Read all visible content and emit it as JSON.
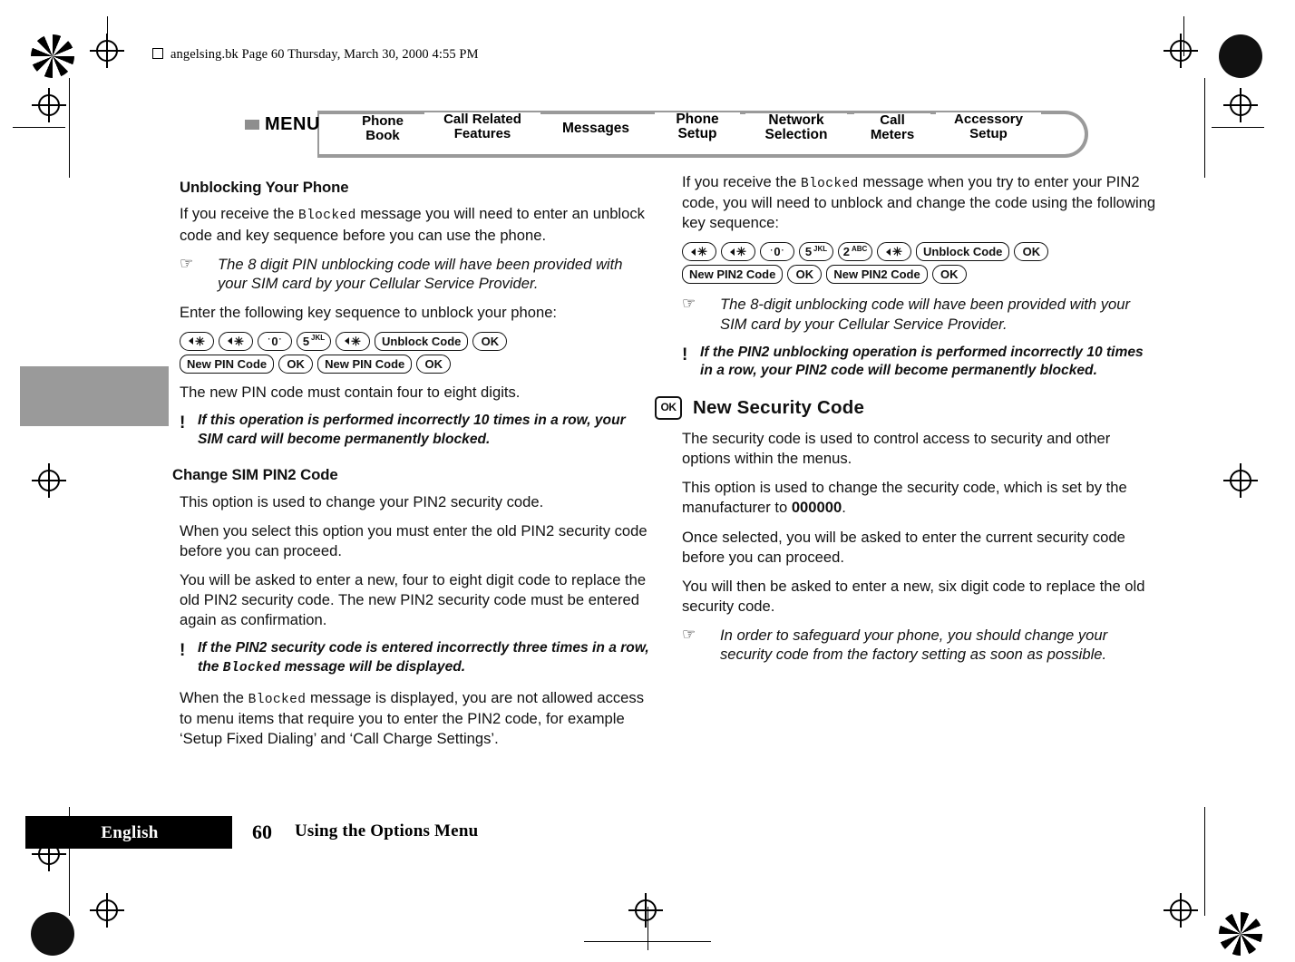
{
  "header": {
    "file_line": "angelsing.bk  Page 60  Thursday, March 30, 2000  4:55 PM"
  },
  "menu_bar": {
    "menu_word": "MENU",
    "items": [
      {
        "label": "Phone\nBook"
      },
      {
        "label": "Call Related\nFeatures"
      },
      {
        "label": "Messages"
      },
      {
        "label": "Phone\nSetup"
      },
      {
        "label": "Network\nSelection"
      },
      {
        "label": "Call\nMeters"
      },
      {
        "label": "Accessory\nSetup"
      }
    ]
  },
  "left_column": {
    "heading_unblocking": "Unblocking Your Phone",
    "p1_a": "If you receive the ",
    "p1_mono": "Blocked",
    "p1_b": " message you will need to enter an unblock code and key sequence before you can use the phone.",
    "note1": "The 8 digit PIN unblocking code will have been provided with your SIM card by your Cellular Service Provider.",
    "p2": "Enter the following key sequence to unblock your phone:",
    "keys_row1": [
      {
        "type": "star"
      },
      {
        "type": "star"
      },
      {
        "type": "zero",
        "label": "0"
      },
      {
        "type": "num",
        "label": "5",
        "sub": "JKL"
      },
      {
        "type": "star"
      },
      {
        "type": "text",
        "label": "Unblock Code"
      },
      {
        "type": "ok",
        "label": "OK"
      }
    ],
    "keys_row2": [
      {
        "type": "text",
        "label": "New PIN Code"
      },
      {
        "type": "ok",
        "label": "OK"
      },
      {
        "type": "text",
        "label": "New PIN Code"
      },
      {
        "type": "ok",
        "label": "OK"
      }
    ],
    "p3": "The new PIN code must contain four to eight digits.",
    "warn1": "If this operation is performed incorrectly 10 times in a row, your SIM card will become permanently blocked.",
    "heading_change_pin2": "Change SIM PIN2 Code",
    "p4": "This option is used to change your PIN2 security code.",
    "p5": "When you select this option you must enter the old PIN2 security code before you can proceed.",
    "p6": "You will be asked to enter a new, four to eight digit code to replace the old PIN2 security code. The new PIN2 security code must be entered again as confirmation.",
    "warn2_a": "If the PIN2 security code is entered incorrectly three times in a row, the ",
    "warn2_mono": "Blocked",
    "warn2_b": " message will be displayed.",
    "p7_a": "When the ",
    "p7_mono": "Blocked",
    "p7_b": " message is displayed, you are not allowed access to menu items that require you to enter the PIN2 code, for example ‘Setup Fixed Dialing’ and ‘Call Charge Settings’."
  },
  "right_column": {
    "p1_a": "If you receive the ",
    "p1_mono": "Blocked",
    "p1_b": " message when you try to enter your PIN2 code, you will need to unblock and change the code using the following key sequence:",
    "keys_row1": [
      {
        "type": "star"
      },
      {
        "type": "star"
      },
      {
        "type": "zero",
        "label": "0"
      },
      {
        "type": "num",
        "label": "5",
        "sub": "JKL"
      },
      {
        "type": "num",
        "label": "2",
        "sub": "ABC"
      },
      {
        "type": "star"
      },
      {
        "type": "text",
        "label": "Unblock Code"
      },
      {
        "type": "ok",
        "label": "OK"
      }
    ],
    "keys_row2": [
      {
        "type": "text",
        "label": "New PIN2 Code"
      },
      {
        "type": "ok",
        "label": "OK"
      },
      {
        "type": "text",
        "label": "New PIN2 Code"
      },
      {
        "type": "ok",
        "label": "OK"
      }
    ],
    "note1": "The 8-digit unblocking code will have been provided with your SIM card by your Cellular Service Provider.",
    "warn1": "If the PIN2 unblocking operation is performed incorrectly 10 times in a row, your PIN2 code will become permanently blocked.",
    "section_heading": "New Security Code",
    "section_heading_icon": "OK",
    "p2": "The security code is used to control access to security and other options within the menus.",
    "p3_a": "This option is used to change the security code, which is set by the manufacturer to ",
    "p3_bold": "000000",
    "p3_b": ".",
    "p4": "Once selected, you will be asked to enter the current security code before you can proceed.",
    "p5": "You will then be asked to enter a new, six digit code to replace the old security code.",
    "note2": "In order to safeguard your phone, you should change your security code from the factory setting as soon as possible."
  },
  "footer": {
    "language": "English",
    "page_number": "60",
    "title": "Using the Options Menu"
  }
}
